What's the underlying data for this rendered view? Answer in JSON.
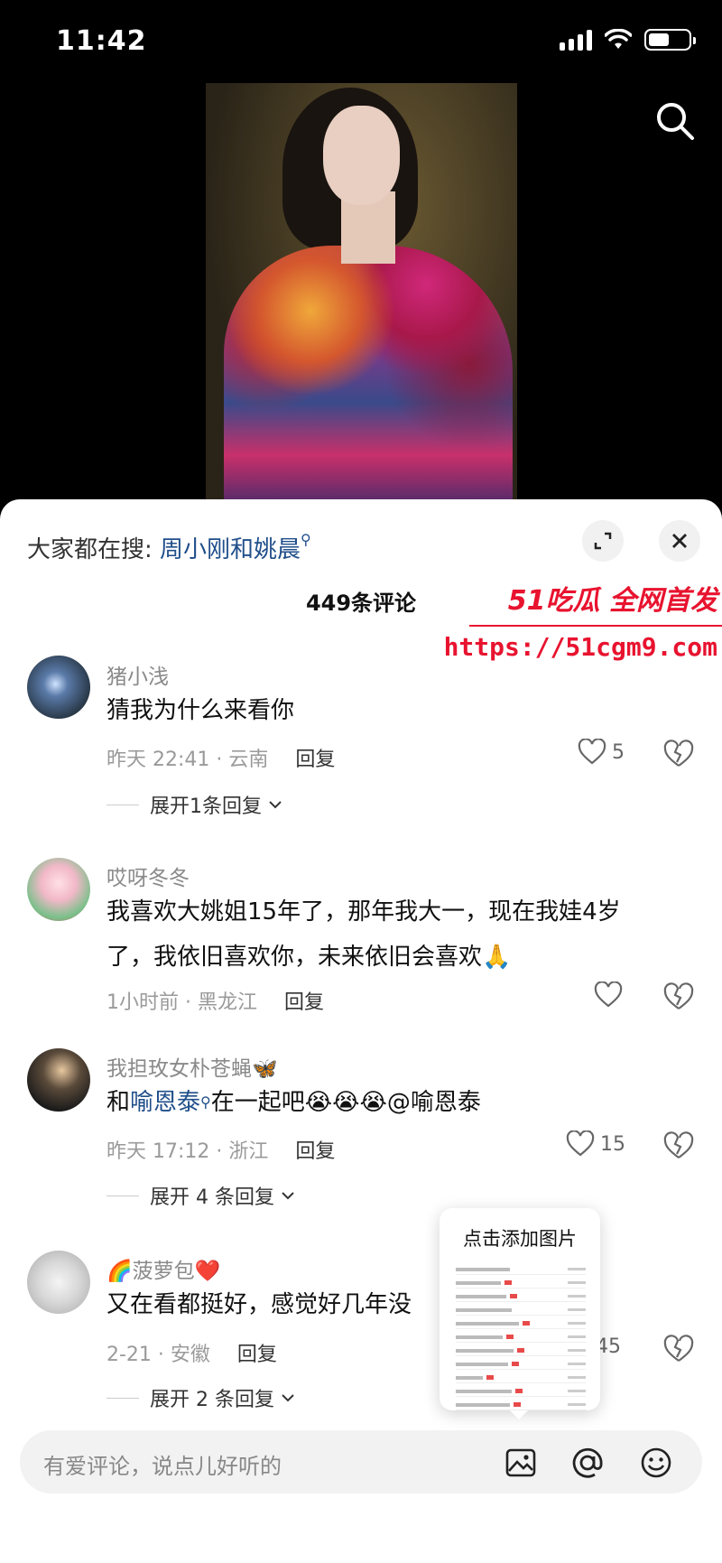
{
  "status_bar": {
    "time": "11:42"
  },
  "search_bar": {
    "prefix": "大家都在搜:",
    "keyword": "周小刚和姚晨"
  },
  "comments_header": {
    "count_label": "449条评论"
  },
  "watermark": {
    "line1": "51吃瓜 全网首发",
    "url": "https://51cgm9.com"
  },
  "comments": [
    {
      "user": "猪小浅",
      "text": "猜我为什么来看你",
      "time_location": "昨天 22:41 · 云南",
      "reply_label": "回复",
      "likes": "5",
      "expand_label": "展开1条回复"
    },
    {
      "user": "哎呀冬冬",
      "text_line1": "我喜欢大姚姐15年了，那年我大一，现在我娃4岁",
      "text_line2": "了，我依旧喜欢你，未来依旧会喜欢",
      "text_emoji": "🙏",
      "time_location": "1小时前 · 黑龙江",
      "reply_label": "回复",
      "likes": ""
    },
    {
      "user": "我担玫女朴苍蝇",
      "user_emoji": "🦋",
      "text_prefix": "和",
      "text_link": "喻恩泰",
      "text_mid": "在一起吧",
      "text_emojis": "😭😭😭",
      "text_suffix": "@喻恩泰",
      "time_location": "昨天 17:12 · 浙江",
      "reply_label": "回复",
      "likes": "15",
      "expand_label": "展开 4 条回复"
    },
    {
      "user_prefix_emoji": "🌈",
      "user": "菠萝包",
      "user_emoji": "❤️",
      "text": "又在看都挺好，感觉好几年没",
      "time_location": "2-21 · 安徽",
      "reply_label": "回复",
      "likes": "45",
      "expand_label": "展开 2 条回复"
    }
  ],
  "popup": {
    "title": "点击添加图片"
  },
  "input": {
    "placeholder": "有爱评论，说点儿好听的"
  },
  "icons": {
    "status": [
      "signal-icon",
      "wifi-icon",
      "battery-icon"
    ],
    "top": "search-icon",
    "sheet": [
      "expand-icon",
      "close-icon"
    ],
    "input": [
      "image-icon",
      "at-icon",
      "emoji-icon"
    ]
  },
  "colors": {
    "link": "#1f4e8a",
    "watermark": "#e8132f"
  }
}
